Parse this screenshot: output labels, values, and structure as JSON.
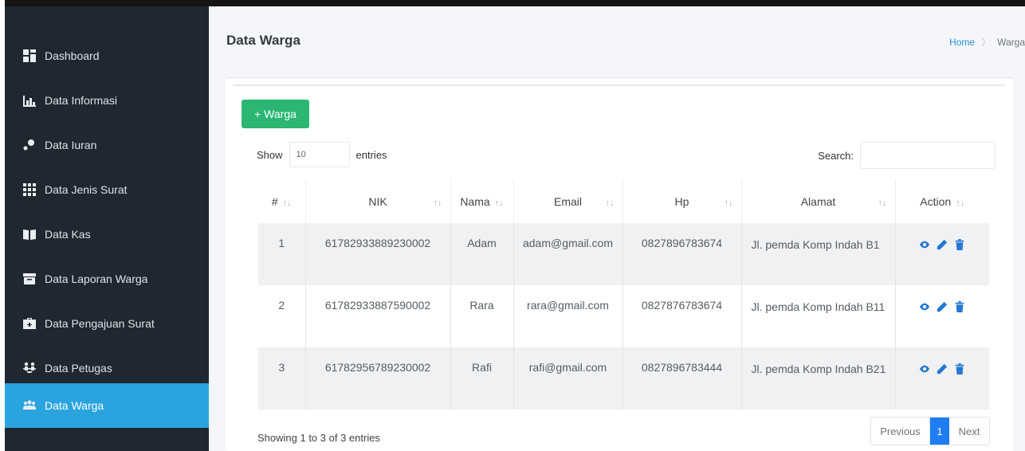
{
  "sidebar": {
    "items": [
      {
        "label": "Dashboard",
        "icon": "dashboard-icon"
      },
      {
        "label": "Data Informasi",
        "icon": "bar-chart-icon"
      },
      {
        "label": "Data Iuran",
        "icon": "donation-icon"
      },
      {
        "label": "Data Jenis Surat",
        "icon": "grid-icon"
      },
      {
        "label": "Data Kas",
        "icon": "book-icon"
      },
      {
        "label": "Data Laporan Warga",
        "icon": "archive-icon"
      },
      {
        "label": "Data Pengajuan Surat",
        "icon": "briefcase-icon"
      },
      {
        "label": "Data Petugas",
        "icon": "people-arrows-icon"
      },
      {
        "label": "Data Warga",
        "icon": "users-icon",
        "active": true
      }
    ]
  },
  "header": {
    "title": "Data Warga",
    "breadcrumb": {
      "home": "Home",
      "current": "Warga"
    }
  },
  "toolbar": {
    "add_label": "+ Warga"
  },
  "length": {
    "show": "Show",
    "value": "10",
    "entries": "entries"
  },
  "search": {
    "label": "Search:"
  },
  "table": {
    "columns": [
      "#",
      "NIK",
      "Nama",
      "Email",
      "Hp",
      "Alamat",
      "Action"
    ],
    "rows": [
      {
        "no": "1",
        "nik": "61782933889230002",
        "nama": "Adam",
        "email": "adam@gmail.com",
        "hp": "0827896783674",
        "alamat": "Jl. pemda Komp Indah B1"
      },
      {
        "no": "2",
        "nik": "61782933887590002",
        "nama": "Rara",
        "email": "rara@gmail.com",
        "hp": "0827876783674",
        "alamat": "Jl. pemda Komp Indah B11"
      },
      {
        "no": "3",
        "nik": "61782956789230002",
        "nama": "Rafi",
        "email": "rafi@gmail.com",
        "hp": "0827896783444",
        "alamat": "Jl. pemda Komp Indah B21"
      }
    ]
  },
  "footer": {
    "info": "Showing 1 to 3 of 3 entries",
    "prev": "Previous",
    "page": "1",
    "next": "Next"
  },
  "colors": {
    "sidebar_bg": "#1f2730",
    "active": "#2aa4de",
    "add_button": "#2bb673",
    "page_active": "#1e7df0",
    "action_icons": "#2477d4"
  }
}
